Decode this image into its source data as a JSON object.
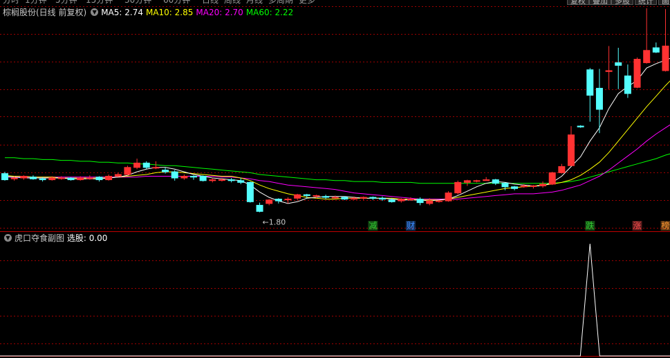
{
  "top_nav": {
    "tabs": [
      "分时",
      "1分钟",
      "5分钟",
      "15分钟",
      "30分钟",
      "60分钟",
      "日线",
      "周线",
      "月线",
      "多周期",
      "更多"
    ],
    "buttons": [
      "复权",
      "叠加",
      "多股",
      "统计",
      "画"
    ]
  },
  "main_legend": {
    "title": "棕榈股份(日线 前复权)",
    "ma": [
      {
        "label": "MA5: 2.74",
        "color": "#ffffff"
      },
      {
        "label": "MA10: 2.85",
        "color": "#ffff00"
      },
      {
        "label": "MA20: 2.70",
        "color": "#ff00ff"
      },
      {
        "label": "MA60: 2.22",
        "color": "#00ff00"
      }
    ]
  },
  "sub_legend": {
    "title": "虎口夺食副图",
    "value_label": "选股: 0.00"
  },
  "chart_data": {
    "type": "candlestick",
    "colors": {
      "up": "#ff3232",
      "down": "#54ffff",
      "ma5": "#ffffff",
      "ma10": "#ffff00",
      "ma20": "#ff00ff",
      "ma60": "#00ff00",
      "grid": "#a00000"
    },
    "price_range": [
      1.7,
      4.25
    ],
    "candles": [
      [
        2.34,
        2.27,
        2.36,
        2.26
      ],
      [
        2.28,
        2.29,
        2.31,
        2.26
      ],
      [
        2.29,
        2.31,
        2.32,
        2.27
      ],
      [
        2.3,
        2.28,
        2.32,
        2.27
      ],
      [
        2.28,
        2.27,
        2.3,
        2.25
      ],
      [
        2.27,
        2.29,
        2.31,
        2.26
      ],
      [
        2.29,
        2.29,
        2.31,
        2.27
      ],
      [
        2.29,
        2.27,
        2.3,
        2.26
      ],
      [
        2.27,
        2.29,
        2.31,
        2.26
      ],
      [
        2.29,
        2.29,
        2.32,
        2.27
      ],
      [
        2.3,
        2.27,
        2.31,
        2.25
      ],
      [
        2.27,
        2.31,
        2.33,
        2.26
      ],
      [
        2.31,
        2.33,
        2.35,
        2.3
      ],
      [
        2.33,
        2.41,
        2.43,
        2.32
      ],
      [
        2.41,
        2.46,
        2.51,
        2.39
      ],
      [
        2.46,
        2.41,
        2.48,
        2.39
      ],
      [
        2.41,
        2.41,
        2.48,
        2.39
      ],
      [
        2.38,
        2.36,
        2.41,
        2.34
      ],
      [
        2.36,
        2.29,
        2.38,
        2.26
      ],
      [
        2.29,
        2.31,
        2.33,
        2.27
      ],
      [
        2.31,
        2.3,
        2.32,
        2.27
      ],
      [
        2.31,
        2.26,
        2.32,
        2.25
      ],
      [
        2.26,
        2.27,
        2.29,
        2.24
      ],
      [
        2.27,
        2.27,
        2.29,
        2.25
      ],
      [
        2.27,
        2.26,
        2.29,
        2.24
      ],
      [
        2.26,
        2.24,
        2.29,
        2.22
      ],
      [
        2.24,
        2.02,
        2.25,
        2.01
      ],
      [
        1.98,
        1.91,
        2.01,
        1.9
      ],
      [
        2.0,
        2.04,
        2.05,
        1.98
      ],
      [
        2.05,
        2.03,
        2.06,
        2.0
      ],
      [
        2.05,
        2.05,
        2.07,
        2.0
      ],
      [
        2.06,
        2.1,
        2.11,
        2.04
      ],
      [
        2.1,
        2.09,
        2.11,
        2.06
      ],
      [
        2.09,
        2.09,
        2.1,
        2.06
      ],
      [
        2.08,
        2.07,
        2.1,
        2.05
      ],
      [
        2.07,
        2.07,
        2.09,
        2.05
      ],
      [
        2.07,
        2.05,
        2.08,
        2.04
      ],
      [
        2.05,
        2.06,
        2.08,
        2.04
      ],
      [
        2.06,
        2.07,
        2.08,
        2.04
      ],
      [
        2.07,
        2.06,
        2.08,
        2.04
      ],
      [
        2.06,
        2.05,
        2.08,
        2.03
      ],
      [
        2.04,
        2.02,
        2.06,
        2.01
      ],
      [
        2.03,
        2.05,
        2.06,
        2.01
      ],
      [
        2.05,
        2.05,
        2.07,
        2.03
      ],
      [
        2.05,
        2.01,
        2.07,
        1.98
      ],
      [
        2.0,
        2.03,
        2.06,
        1.98
      ],
      [
        2.03,
        2.03,
        2.04,
        2.01
      ],
      [
        2.03,
        2.12,
        2.14,
        2.02
      ],
      [
        2.12,
        2.24,
        2.26,
        2.1
      ],
      [
        2.24,
        2.26,
        2.27,
        2.2
      ],
      [
        2.26,
        2.26,
        2.27,
        2.24
      ],
      [
        2.26,
        2.27,
        2.3,
        2.26
      ],
      [
        2.27,
        2.23,
        2.28,
        2.21
      ],
      [
        2.23,
        2.19,
        2.24,
        2.15
      ],
      [
        2.19,
        2.17,
        2.2,
        2.15
      ],
      [
        2.19,
        2.2,
        2.22,
        2.18
      ],
      [
        2.2,
        2.2,
        2.21,
        2.17
      ],
      [
        2.2,
        2.22,
        2.25,
        2.18
      ],
      [
        2.22,
        2.35,
        2.36,
        2.21
      ],
      [
        2.35,
        2.42,
        2.45,
        2.34
      ],
      [
        2.43,
        2.78,
        2.88,
        2.46
      ],
      [
        2.88,
        2.87,
        2.89,
        2.86
      ],
      [
        3.52,
        3.23,
        3.54,
        2.93
      ],
      [
        3.31,
        3.07,
        3.53,
        2.8
      ],
      [
        3.5,
        3.51,
        3.79,
        3.3
      ],
      [
        3.6,
        3.57,
        3.77,
        3.3
      ],
      [
        3.45,
        3.25,
        3.58,
        3.2
      ],
      [
        3.32,
        3.64,
        3.66,
        3.31
      ],
      [
        3.6,
        3.74,
        4.22,
        3.59
      ],
      [
        3.77,
        3.72,
        3.83,
        3.71
      ],
      [
        3.51,
        3.79,
        4.21,
        3.5
      ],
      [
        3.58,
        3.51,
        3.79,
        3.43
      ]
    ],
    "ma5": [
      2.31,
      2.3,
      2.29,
      2.29,
      2.29,
      2.29,
      2.29,
      2.28,
      2.28,
      2.28,
      2.28,
      2.29,
      2.3,
      2.32,
      2.36,
      2.39,
      2.41,
      2.41,
      2.39,
      2.36,
      2.33,
      2.31,
      2.29,
      2.28,
      2.27,
      2.26,
      2.21,
      2.13,
      2.07,
      2.03,
      2.0,
      2.02,
      2.06,
      2.07,
      2.08,
      2.08,
      2.08,
      2.07,
      2.06,
      2.06,
      2.06,
      2.05,
      2.04,
      2.04,
      2.04,
      2.03,
      2.04,
      2.05,
      2.09,
      2.14,
      2.19,
      2.23,
      2.25,
      2.24,
      2.22,
      2.21,
      2.2,
      2.2,
      2.24,
      2.31,
      2.42,
      2.53,
      2.71,
      2.86,
      3.08,
      3.25,
      3.33,
      3.4,
      3.54,
      3.59,
      3.63,
      3.67
    ],
    "ma10": [
      2.32,
      2.31,
      2.31,
      2.3,
      2.3,
      2.3,
      2.29,
      2.29,
      2.29,
      2.29,
      2.29,
      2.29,
      2.3,
      2.31,
      2.32,
      2.33,
      2.35,
      2.36,
      2.36,
      2.35,
      2.34,
      2.33,
      2.32,
      2.31,
      2.31,
      2.29,
      2.26,
      2.21,
      2.17,
      2.14,
      2.11,
      2.09,
      2.07,
      2.06,
      2.05,
      2.05,
      2.06,
      2.06,
      2.06,
      2.06,
      2.06,
      2.06,
      2.05,
      2.05,
      2.04,
      2.04,
      2.04,
      2.05,
      2.07,
      2.09,
      2.11,
      2.13,
      2.15,
      2.17,
      2.18,
      2.19,
      2.2,
      2.21,
      2.22,
      2.24,
      2.27,
      2.32,
      2.39,
      2.47,
      2.58,
      2.71,
      2.84,
      2.97,
      3.1,
      3.22,
      3.34,
      3.45
    ],
    "ma20": [
      2.3,
      2.3,
      2.3,
      2.3,
      2.3,
      2.3,
      2.3,
      2.3,
      2.3,
      2.3,
      2.3,
      2.3,
      2.3,
      2.3,
      2.3,
      2.31,
      2.31,
      2.31,
      2.31,
      2.31,
      2.31,
      2.31,
      2.31,
      2.3,
      2.3,
      2.29,
      2.28,
      2.26,
      2.25,
      2.23,
      2.21,
      2.2,
      2.19,
      2.18,
      2.17,
      2.16,
      2.14,
      2.12,
      2.11,
      2.1,
      2.09,
      2.08,
      2.07,
      2.06,
      2.05,
      2.05,
      2.05,
      2.05,
      2.05,
      2.06,
      2.07,
      2.08,
      2.09,
      2.1,
      2.11,
      2.11,
      2.11,
      2.12,
      2.13,
      2.15,
      2.18,
      2.21,
      2.26,
      2.31,
      2.38,
      2.46,
      2.54,
      2.62,
      2.71,
      2.79,
      2.86,
      2.93
    ],
    "ma60": [
      2.52,
      2.52,
      2.51,
      2.51,
      2.5,
      2.5,
      2.49,
      2.49,
      2.48,
      2.48,
      2.47,
      2.47,
      2.46,
      2.46,
      2.45,
      2.45,
      2.44,
      2.43,
      2.43,
      2.42,
      2.41,
      2.4,
      2.39,
      2.38,
      2.37,
      2.36,
      2.35,
      2.33,
      2.32,
      2.31,
      2.3,
      2.29,
      2.28,
      2.27,
      2.27,
      2.26,
      2.26,
      2.25,
      2.25,
      2.25,
      2.24,
      2.24,
      2.24,
      2.24,
      2.23,
      2.23,
      2.23,
      2.23,
      2.23,
      2.23,
      2.23,
      2.23,
      2.23,
      2.23,
      2.23,
      2.23,
      2.23,
      2.23,
      2.23,
      2.24,
      2.25,
      2.27,
      2.3,
      2.33,
      2.36,
      2.39,
      2.42,
      2.45,
      2.48,
      2.51,
      2.55,
      2.58
    ],
    "low_annotation": {
      "index": 27,
      "label": "←1.80"
    },
    "events": [
      {
        "index": 39,
        "label": "减",
        "color": "#33cc33"
      },
      {
        "index": 43,
        "label": "财",
        "color": "#3b8bff"
      },
      {
        "index": 62,
        "label": "跌",
        "color": "#33cc33"
      },
      {
        "index": 67,
        "label": "涨",
        "color": "#ff5050"
      },
      {
        "index": 70,
        "label": "榜",
        "color": "#ff9933"
      }
    ],
    "indicator": {
      "name": "选股",
      "values_nonzero": [
        {
          "index": 62,
          "value": 1
        }
      ],
      "range": [
        0,
        1
      ]
    }
  }
}
